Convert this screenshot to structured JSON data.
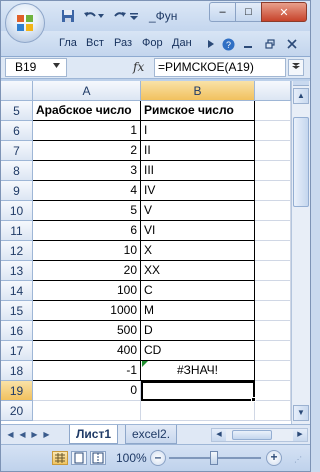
{
  "window": {
    "title": "_Фун",
    "minimize_glyph": "–",
    "maximize_glyph": "□",
    "close_glyph": "✕"
  },
  "ribbon": {
    "tabs": [
      "Гла",
      "Вст",
      "Раз",
      "Фор",
      "Дан"
    ]
  },
  "formula_bar": {
    "name_box": "B19",
    "fx_label": "fx",
    "formula": "=РИМСКОЕ(A19)"
  },
  "grid": {
    "columns": [
      "A",
      "B"
    ],
    "selected_column": "B",
    "rows": [
      {
        "n": "5",
        "a": "Арабское число",
        "b": "Римское число"
      },
      {
        "n": "6",
        "a": "1",
        "b": "I"
      },
      {
        "n": "7",
        "a": "2",
        "b": "II"
      },
      {
        "n": "8",
        "a": "3",
        "b": "III"
      },
      {
        "n": "9",
        "a": "4",
        "b": "IV"
      },
      {
        "n": "10",
        "a": "5",
        "b": "V"
      },
      {
        "n": "11",
        "a": "6",
        "b": "VI"
      },
      {
        "n": "12",
        "a": "10",
        "b": "X"
      },
      {
        "n": "13",
        "a": "20",
        "b": "XX"
      },
      {
        "n": "14",
        "a": "100",
        "b": "C"
      },
      {
        "n": "15",
        "a": "1000",
        "b": "M"
      },
      {
        "n": "16",
        "a": "500",
        "b": "D"
      },
      {
        "n": "17",
        "a": "400",
        "b": "CD"
      },
      {
        "n": "18",
        "a": "-1",
        "b": "#ЗНАЧ!"
      },
      {
        "n": "19",
        "a": "0",
        "b": ""
      },
      {
        "n": "20",
        "a": "",
        "b": ""
      }
    ],
    "active_row": "19",
    "error_row": "18"
  },
  "sheets": {
    "tabs": [
      "Лист1",
      "excel2."
    ],
    "active": "Лист1"
  },
  "statusbar": {
    "zoom": "100%",
    "zoom_minus": "–",
    "zoom_plus": "+"
  },
  "colors": {
    "accent": "#1f3a66",
    "selected_header": "#f1c15e",
    "error_indicator": "#1f8f2e"
  }
}
